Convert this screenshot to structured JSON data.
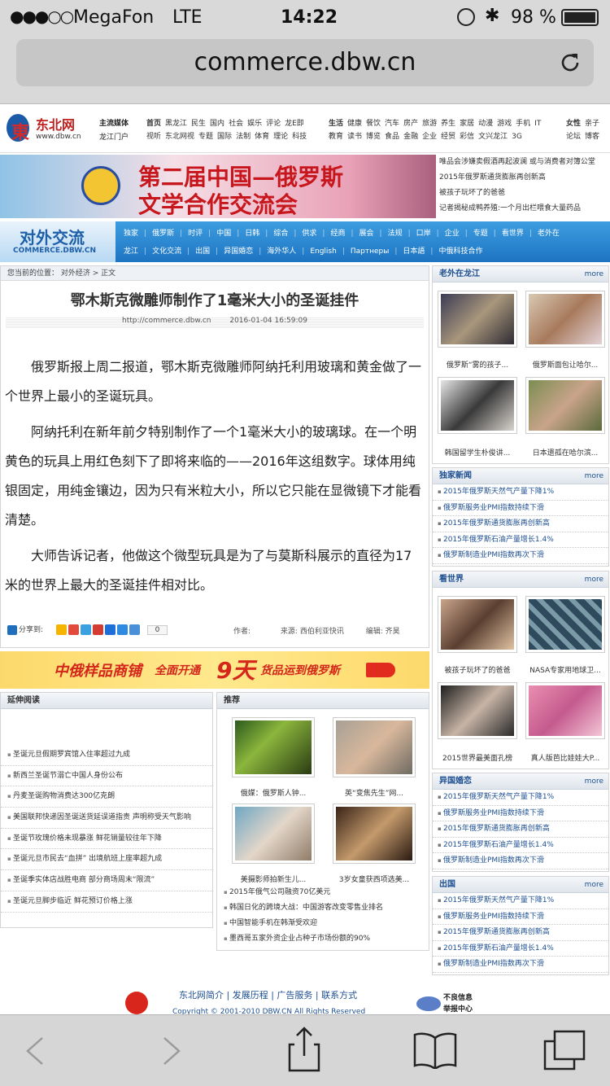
{
  "status": {
    "carrier": "MegaFon",
    "network": "LTE",
    "time": "14:22",
    "battery": "98 %"
  },
  "browser": {
    "url": "commerce.dbw.cn"
  },
  "site": {
    "logo_cn": "东北网",
    "logo_en": "www.dbw.cn",
    "slogan1": "主流媒体",
    "slogan2": "龙江门户",
    "nav_row1a": [
      "首页",
      "黑龙江",
      "民生",
      "国内",
      "社会",
      "娱乐",
      "评论",
      "龙E即"
    ],
    "nav_row2a": [
      "视听",
      "东北网视",
      "专题",
      "国际",
      "法制",
      "体育",
      "理论",
      "科技"
    ],
    "nav_row1b": [
      "生活",
      "健康",
      "餐饮",
      "汽车",
      "房产",
      "旅游",
      "养生",
      "家居",
      "动漫",
      "游戏",
      "手机",
      "IT"
    ],
    "nav_row2b": [
      "教育",
      "读书",
      "博览",
      "食品",
      "金融",
      "企业",
      "经贸",
      "彩信",
      "文兴龙江",
      "3G"
    ],
    "nav_row1c": [
      "女性",
      "亲子"
    ],
    "nav_row2c": [
      "论坛",
      "博客"
    ]
  },
  "banner": {
    "line1": "第二届中国—俄罗斯",
    "line2": "文学合作交流会",
    "side_links": [
      "唯品会涉嫌卖假酒再起波澜 或与消费者对簿公堂",
      "2015年俄罗斯通货膨胀再创新高",
      "被孩子玩坏了的爸爸",
      "记者揭秘成鸭养殖:一个月出栏喂食大量药品"
    ]
  },
  "section": {
    "title_cn": "对外交流",
    "title_en": "COMMERCE.DBW.CN",
    "nav1": [
      "独家",
      "俄罗斯",
      "时评",
      "中国",
      "日韩",
      "综合",
      "供求",
      "经商",
      "展会",
      "法规",
      "口岸",
      "企业",
      "专题",
      "看世界",
      "老外在"
    ],
    "nav2": [
      "龙江",
      "文化交流",
      "出国",
      "异国婚恋",
      "海外华人",
      "English",
      "Партнеры",
      "日本語",
      "中俄科技合作"
    ]
  },
  "breadcrumb": "您当前的位置： 对外经济 > 正文",
  "article": {
    "title": "鄂木斯克微雕师制作了1毫米大小的圣诞挂件",
    "source_url": "http://commerce.dbw.cn",
    "date": "2016-01-04 16:59:09",
    "paragraphs": [
      "俄罗斯报上周二报道，鄂木斯克微雕师阿纳托利用玻璃和黄金做了一个世界上最小的圣诞玩具。",
      "阿纳托利在新年前夕特别制作了一个1毫米大小的玻璃球。在一个明黄色的玩具上用红色刻下了即将来临的——2016年这组数字。球体用纯银固定，用纯金镶边，因为只有米粒大小，所以它只能在显微镜下才能看清楚。",
      "大师告诉记者，他做这个微型玩具是为了与莫斯科展示的直径为17米的世界上最大的圣诞挂件相对比。"
    ],
    "share_label": "分享到:",
    "share_count": "0",
    "author_label": "作者:",
    "source_label": "来源:",
    "source_value": "西伯利亚快讯",
    "editor_label": "编辑:",
    "editor_value": "齐昊"
  },
  "ad": {
    "text1": "中俄样品商铺",
    "text2": "全面开通",
    "text3": "9天",
    "text4": "货品运到俄罗斯"
  },
  "extended": {
    "title": "延伸阅读",
    "items": [
      "圣诞元旦假期罗宾馆入住率超过九成",
      "新西兰圣诞节溺亡中国人身份公布",
      "丹麦圣诞购物消费达300亿克朗",
      "美国联邦快递因圣诞送货延误道指责 声明称受天气影响",
      "圣诞节玫瑰价格未现暴涨 鲜花销量较往年下降",
      "圣诞元旦市民去“血拼” 出境航班上座率超九成",
      "圣诞季实体店战胜电商 部分商场周末“限流”",
      "圣诞元旦脚步临近 鲜花预订价格上涨"
    ]
  },
  "recommend": {
    "title": "推荐",
    "thumbs": [
      "俄媒：俄罗斯人钟...",
      "英“变焦先生”网...",
      "美摄影师拍新生儿...",
      "3岁女童获西项选美..."
    ],
    "items": [
      "2015年俄气公司融资70亿美元",
      "韩国日化的跨境大战：中国游客改变零售业排名",
      "中国智能手机在韩渐受欢迎",
      "墨西哥五家外资企业占种子市场份额的90%"
    ]
  },
  "sidebar": {
    "more": "more",
    "laowai": {
      "title": "老外在龙江",
      "captions": [
        "俄罗斯“雾的孩子...",
        "俄罗斯面包让哈尔...",
        "韩国留学生朴俊讲...",
        "日本遗孤在哈尔滨..."
      ]
    },
    "dujia": {
      "title": "独家新闻",
      "items": [
        "2015年俄罗斯天然气产量下降1%",
        "俄罗斯服务业PMI指数持续下滑",
        "2015年俄罗斯通货膨胀再创新高",
        "2015年俄罗斯石油产量增长1.4%",
        "俄罗斯制造业PMI指数再次下滑"
      ]
    },
    "kan": {
      "title": "看世界",
      "captions": [
        "被孩子玩坏了的爸爸",
        "NASA专家用地球卫...",
        "2015世界最美面孔榜",
        "真人版芭比娃娃大P..."
      ]
    },
    "yiguo": {
      "title": "异国婚恋",
      "items": [
        "2015年俄罗斯天然气产量下降1%",
        "俄罗斯服务业PMI指数持续下滑",
        "2015年俄罗斯通货膨胀再创新高",
        "2015年俄罗斯石油产量增长1.4%",
        "俄罗斯制造业PMI指数再次下滑"
      ]
    },
    "chuguo": {
      "title": "出国",
      "items": [
        "2015年俄罗斯天然气产量下降1%",
        "俄罗斯服务业PMI指数持续下滑",
        "2015年俄罗斯通货膨胀再创新高",
        "2015年俄罗斯石油产量增长1.4%",
        "俄罗斯制造业PMI指数再次下滑"
      ]
    }
  },
  "footer": {
    "links": [
      "东北网简介",
      "发展历程",
      "广告服务",
      "联系方式"
    ],
    "copyright": "Copyright © 2001-2010 DBW.CN All Rights Reserved",
    "report1": "不良信息",
    "report2": "举报中心"
  }
}
